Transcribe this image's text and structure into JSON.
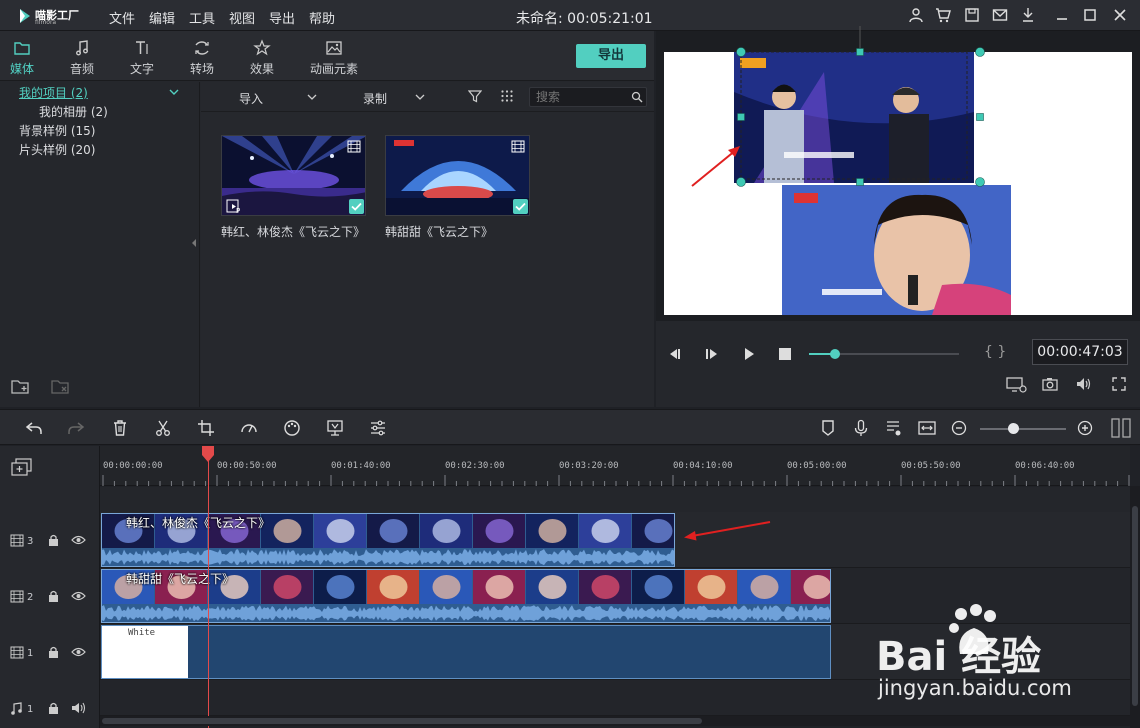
{
  "app": {
    "logo_text": "喵影工厂",
    "logo_sub": "filmora",
    "title": "未命名: 00:05:21:01",
    "menu": [
      "文件",
      "编辑",
      "工具",
      "视图",
      "导出",
      "帮助"
    ]
  },
  "tabs": [
    {
      "label": "媒体"
    },
    {
      "label": "音频"
    },
    {
      "label": "文字"
    },
    {
      "label": "转场"
    },
    {
      "label": "效果"
    },
    {
      "label": "动画元素"
    }
  ],
  "export_label": "导出",
  "tree": {
    "my_project": "我的项目 (2)",
    "my_album": "我的相册 (2)",
    "bg_samples": "背景样例 (15)",
    "intro_samples": "片头样例 (20)"
  },
  "media_toolbar": {
    "import_label": "导入",
    "record_label": "录制",
    "search_placeholder": "搜索"
  },
  "media_items": [
    {
      "label": "韩红、林俊杰《飞云之下》"
    },
    {
      "label": "韩甜甜《飞云之下》"
    }
  ],
  "preview": {
    "timecode": "00:00:47:03",
    "braces": "{  }",
    "progress": 0.17
  },
  "ruler_ticks": [
    "00:00:00:00",
    "00:00:50:00",
    "00:01:40:00",
    "00:02:30:00",
    "00:03:20:00",
    "00:04:10:00",
    "00:05:00:00",
    "00:05:50:00",
    "00:06:40:00"
  ],
  "tracks": [
    {
      "num": "3",
      "clip_title": "韩红、林俊杰《飞云之下》"
    },
    {
      "num": "2",
      "clip_title": "韩甜甜《飞云之下》"
    },
    {
      "num": "1",
      "clip_title": "White"
    },
    {
      "num": "1"
    }
  ],
  "watermark": {
    "brand": "Bai 经验",
    "url": "jingyan.baidu.com"
  },
  "colors": {
    "accent": "#52cfc0",
    "clip": "#2f5d91",
    "playhead": "#e34a4a",
    "annotation_arrow": "#e02020"
  }
}
